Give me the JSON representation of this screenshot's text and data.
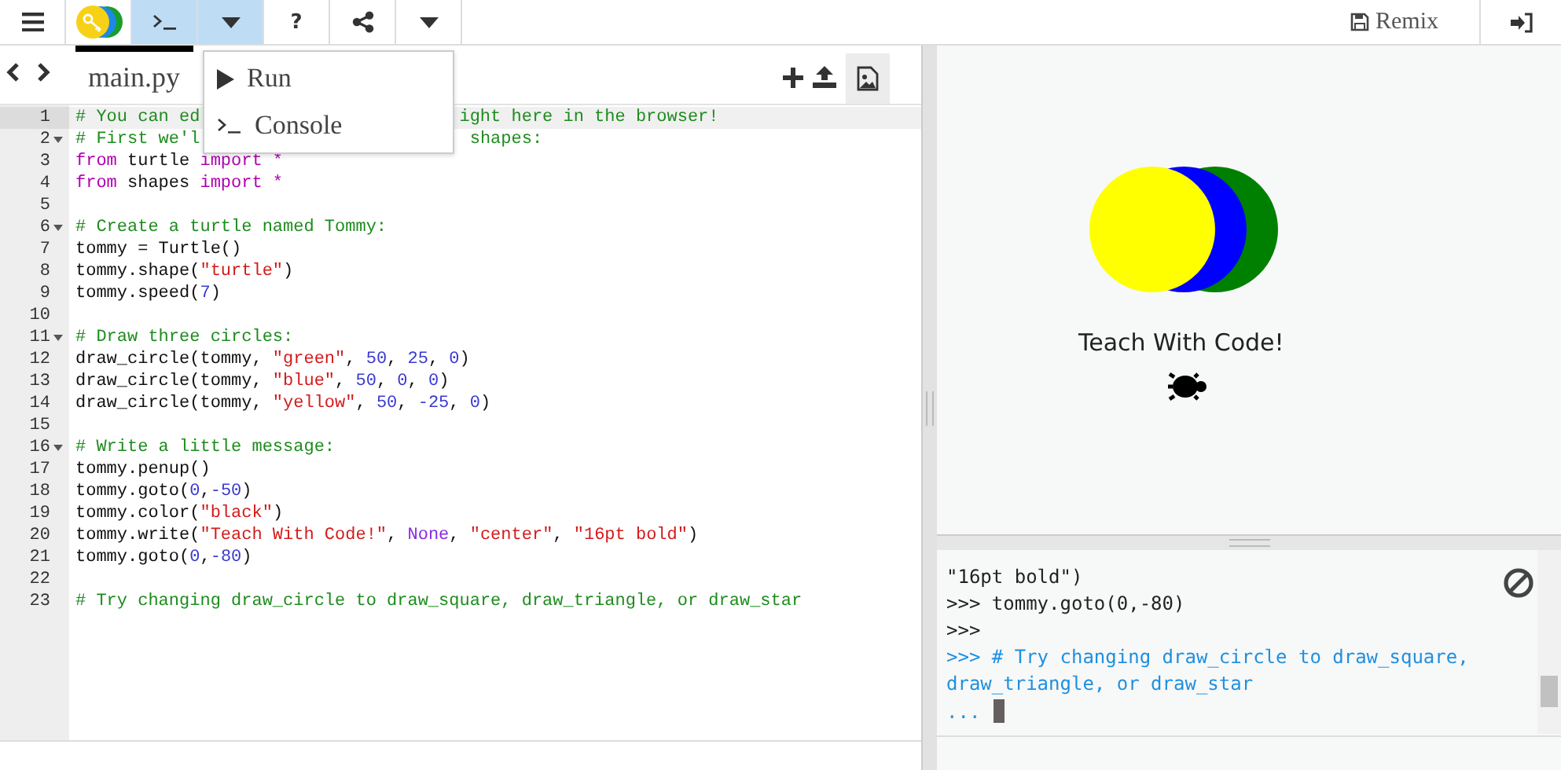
{
  "toolbar": {
    "buttons": [
      {
        "kind": "menu",
        "selected": false
      },
      {
        "kind": "logo",
        "selected": false
      },
      {
        "kind": "console",
        "selected": true
      },
      {
        "kind": "caret",
        "selected": true
      },
      {
        "kind": "help",
        "label": "?",
        "selected": false
      },
      {
        "kind": "share",
        "selected": false
      },
      {
        "kind": "caret",
        "selected": false
      }
    ],
    "remix": {
      "label": "Remix"
    }
  },
  "dropdown": {
    "items": [
      {
        "kind": "run",
        "label": "Run"
      },
      {
        "kind": "console",
        "label": "Console"
      }
    ]
  },
  "editor": {
    "tabs": [
      {
        "label": "main.py",
        "selected": true
      }
    ],
    "lines": [
      {
        "number": "1",
        "active": true,
        "fold": false,
        "tokens": [
          {
            "kind": "comment",
            "text": "# You can ed"
          },
          {
            "kind": "covered"
          },
          {
            "kind": "comment",
            "text": "ight here in the browser!"
          }
        ]
      },
      {
        "number": "2",
        "active": false,
        "fold": true,
        "tokens": [
          {
            "kind": "comment",
            "text": "# First we'l"
          },
          {
            "kind": "covered"
          },
          {
            "kind": "comment",
            "text": "shapes:"
          }
        ]
      },
      {
        "number": "3",
        "active": false,
        "fold": false,
        "tokens": [
          {
            "kind": "keyword",
            "text": "from"
          },
          {
            "kind": "plain",
            "text": " turtle "
          },
          {
            "kind": "keyword",
            "text": "import *"
          }
        ]
      },
      {
        "number": "4",
        "active": false,
        "fold": false,
        "tokens": [
          {
            "kind": "keyword",
            "text": "from"
          },
          {
            "kind": "plain",
            "text": " shapes "
          },
          {
            "kind": "keyword",
            "text": "import *"
          }
        ]
      },
      {
        "number": "5",
        "active": false,
        "fold": false
      },
      {
        "number": "6",
        "active": false,
        "fold": true,
        "tokens": [
          {
            "kind": "comment",
            "text": "# Create a turtle named Tommy:"
          }
        ]
      },
      {
        "number": "7",
        "active": false,
        "fold": false,
        "tokens": [
          {
            "kind": "plain",
            "text": "tommy = Turtle()"
          }
        ]
      },
      {
        "number": "8",
        "active": false,
        "fold": false,
        "tokens": [
          {
            "kind": "plain",
            "text": "tommy.shape("
          },
          {
            "kind": "string",
            "text": "\"turtle\""
          },
          {
            "kind": "plain",
            "text": ")"
          }
        ]
      },
      {
        "number": "9",
        "active": false,
        "fold": false,
        "tokens": [
          {
            "kind": "plain",
            "text": "tommy.speed("
          },
          {
            "kind": "number",
            "text": "7"
          },
          {
            "kind": "plain",
            "text": ")"
          }
        ]
      },
      {
        "number": "10",
        "active": false,
        "fold": false
      },
      {
        "number": "11",
        "active": false,
        "fold": true,
        "tokens": [
          {
            "kind": "comment",
            "text": "# Draw three circles:"
          }
        ]
      },
      {
        "number": "12",
        "active": false,
        "fold": false,
        "tokens": [
          {
            "kind": "plain",
            "text": "draw_circle(tommy, "
          },
          {
            "kind": "string",
            "text": "\"green\""
          },
          {
            "kind": "plain",
            "text": ", "
          },
          {
            "kind": "number",
            "text": "50"
          },
          {
            "kind": "plain",
            "text": ", "
          },
          {
            "kind": "number",
            "text": "25"
          },
          {
            "kind": "plain",
            "text": ", "
          },
          {
            "kind": "number",
            "text": "0"
          },
          {
            "kind": "plain",
            "text": ")"
          }
        ]
      },
      {
        "number": "13",
        "active": false,
        "fold": false,
        "tokens": [
          {
            "kind": "plain",
            "text": "draw_circle(tommy, "
          },
          {
            "kind": "string",
            "text": "\"blue\""
          },
          {
            "kind": "plain",
            "text": ", "
          },
          {
            "kind": "number",
            "text": "50"
          },
          {
            "kind": "plain",
            "text": ", "
          },
          {
            "kind": "number",
            "text": "0"
          },
          {
            "kind": "plain",
            "text": ", "
          },
          {
            "kind": "number",
            "text": "0"
          },
          {
            "kind": "plain",
            "text": ")"
          }
        ]
      },
      {
        "number": "14",
        "active": false,
        "fold": false,
        "tokens": [
          {
            "kind": "plain",
            "text": "draw_circle(tommy, "
          },
          {
            "kind": "string",
            "text": "\"yellow\""
          },
          {
            "kind": "plain",
            "text": ", "
          },
          {
            "kind": "number",
            "text": "50"
          },
          {
            "kind": "plain",
            "text": ", "
          },
          {
            "kind": "number",
            "text": "-25"
          },
          {
            "kind": "plain",
            "text": ", "
          },
          {
            "kind": "number",
            "text": "0"
          },
          {
            "kind": "plain",
            "text": ")"
          }
        ]
      },
      {
        "number": "15",
        "active": false,
        "fold": false
      },
      {
        "number": "16",
        "active": false,
        "fold": true,
        "tokens": [
          {
            "kind": "comment",
            "text": "# Write a little message:"
          }
        ]
      },
      {
        "number": "17",
        "active": false,
        "fold": false,
        "tokens": [
          {
            "kind": "plain",
            "text": "tommy.penup()"
          }
        ]
      },
      {
        "number": "18",
        "active": false,
        "fold": false,
        "tokens": [
          {
            "kind": "plain",
            "text": "tommy.goto("
          },
          {
            "kind": "number",
            "text": "0"
          },
          {
            "kind": "plain",
            "text": ","
          },
          {
            "kind": "number",
            "text": "-50"
          },
          {
            "kind": "plain",
            "text": ")"
          }
        ]
      },
      {
        "number": "19",
        "active": false,
        "fold": false,
        "tokens": [
          {
            "kind": "plain",
            "text": "tommy.color("
          },
          {
            "kind": "string",
            "text": "\"black\""
          },
          {
            "kind": "plain",
            "text": ")"
          }
        ]
      },
      {
        "number": "20",
        "active": false,
        "fold": false,
        "tokens": [
          {
            "kind": "plain",
            "text": "tommy.write("
          },
          {
            "kind": "string",
            "text": "\"Teach With Code!\""
          },
          {
            "kind": "plain",
            "text": ", "
          },
          {
            "kind": "atom",
            "text": "None"
          },
          {
            "kind": "plain",
            "text": ", "
          },
          {
            "kind": "string",
            "text": "\"center\""
          },
          {
            "kind": "plain",
            "text": ", "
          },
          {
            "kind": "string",
            "text": "\"16pt bold\""
          },
          {
            "kind": "plain",
            "text": ")"
          }
        ]
      },
      {
        "number": "21",
        "active": false,
        "fold": false,
        "tokens": [
          {
            "kind": "plain",
            "text": "tommy.goto("
          },
          {
            "kind": "number",
            "text": "0"
          },
          {
            "kind": "plain",
            "text": ","
          },
          {
            "kind": "number",
            "text": "-80"
          },
          {
            "kind": "plain",
            "text": ")"
          }
        ]
      },
      {
        "number": "22",
        "active": false,
        "fold": false
      },
      {
        "number": "23",
        "active": false,
        "fold": false,
        "tokens": [
          {
            "kind": "comment",
            "text": "# Try changing draw_circle to draw_square, draw_triangle, or draw_star"
          }
        ]
      }
    ]
  },
  "output": {
    "message": "Teach With Code!"
  },
  "console": {
    "lines": [
      {
        "kind": "output",
        "text": "\"16pt bold\")"
      },
      {
        "kind": "output",
        "text": ">>> tommy.goto(0,-80)"
      },
      {
        "kind": "output",
        "text": ">>>"
      },
      {
        "kind": "input",
        "text": ">>> # Try changing draw_circle to draw_square,"
      },
      {
        "kind": "input",
        "text": "draw_triangle, or draw_star"
      }
    ],
    "prompt": "..."
  }
}
